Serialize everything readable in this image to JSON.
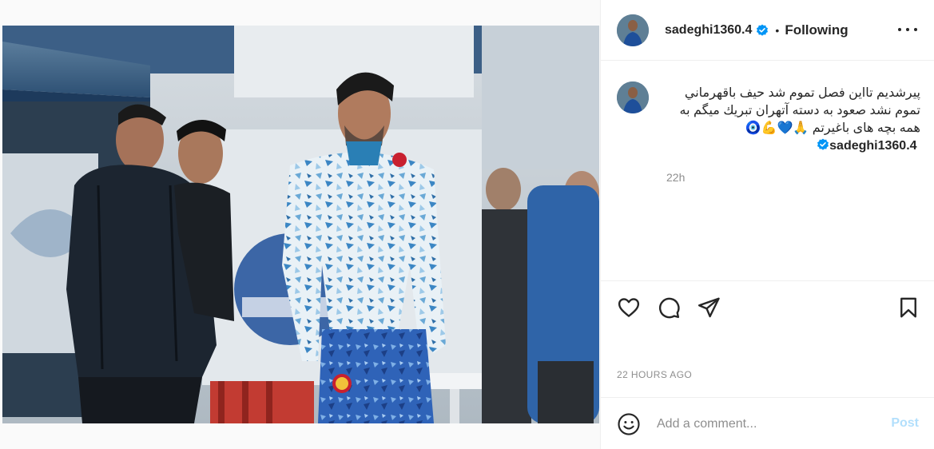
{
  "post": {
    "username": "sadeghi1360.4",
    "follow_status": "Following",
    "dot": "•",
    "caption_user": "sadeghi1360.4",
    "caption_text": "پیرشدیم تااین فصل تموم شد حیف باقهرماني تموم نشد صعود به دسته آتهران تبريك ميگم به همه بچه های باغیرتم 🙏💙💪🧿",
    "time_ago": "22h",
    "date_label": "22 HOURS AGO",
    "verified": true
  },
  "comment": {
    "placeholder": "Add a comment...",
    "post_label": "Post"
  },
  "icons": {
    "more": "more-options-icon",
    "like": "heart-icon",
    "comment": "comment-icon",
    "share": "share-icon",
    "save": "bookmark-icon",
    "emoji": "emoji-icon",
    "verified": "verified-badge-icon"
  },
  "colors": {
    "verified_blue": "#0095f6",
    "post_disabled": "#b2dffc",
    "secondary_text": "#8e8e8e",
    "divider": "#efefef"
  }
}
